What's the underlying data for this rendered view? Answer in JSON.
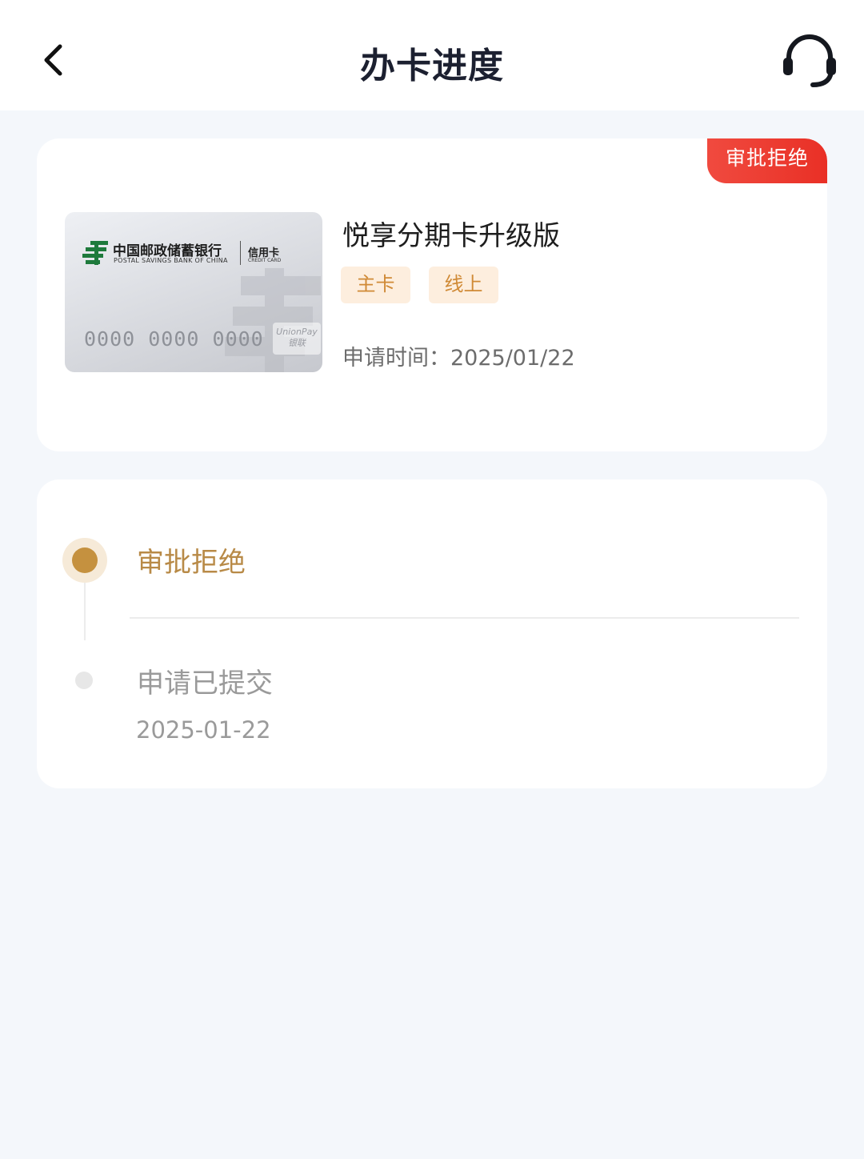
{
  "header": {
    "title": "办卡进度",
    "back_icon": "chevron-left-icon",
    "service_icon": "headset-icon"
  },
  "application": {
    "status_tag": "审批拒绝",
    "card": {
      "bank_name_cn": "中国邮政储蓄银行",
      "bank_name_en": "POSTAL SAVINGS BANK OF CHINA",
      "card_type_cn": "信用卡",
      "card_type_en": "CREDIT CARD",
      "number": "0000 0000 0000",
      "network_en": "UnionPay",
      "network_cn": "银联"
    },
    "card_name": "悦享分期卡升级版",
    "tags": [
      "主卡",
      "线上"
    ],
    "apply_time": "申请时间：2025/01/22"
  },
  "timeline": {
    "steps": [
      {
        "label": "审批拒绝",
        "date": "",
        "active": true
      },
      {
        "label": "申请已提交",
        "date": "2025-01-22",
        "active": false
      }
    ]
  },
  "colors": {
    "accent_gold": "#c5913f",
    "reject_red": "#e93026",
    "tag_bg": "#fdeede",
    "tag_text": "#d08a36"
  }
}
